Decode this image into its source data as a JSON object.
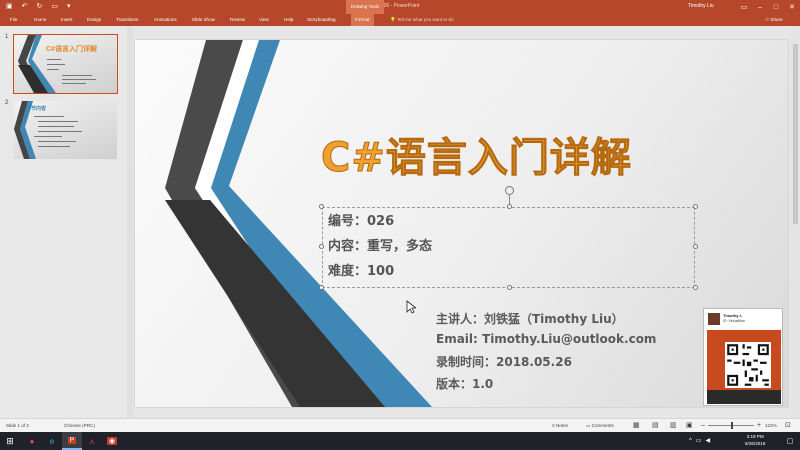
{
  "window": {
    "title": "326 - PowerPoint",
    "context_tab_group": "Drawing Tools",
    "user": "Timothy Liu",
    "qat_icons": [
      "save-icon",
      "undo-icon",
      "redo-icon",
      "present-icon",
      "customize-icon"
    ]
  },
  "ribbon": {
    "tabs": [
      "File",
      "Home",
      "Insert",
      "Design",
      "Transitions",
      "Animations",
      "Slide Show",
      "Review",
      "View",
      "Help",
      "Storyboarding",
      "Format"
    ],
    "active_tab": "Format",
    "tell_me": "Tell me what you want to do",
    "share": "Share"
  },
  "thumbnails": [
    {
      "number": "1",
      "title": "C#语言入门详解",
      "selected": true
    },
    {
      "number": "2",
      "title": "本节内容",
      "selected": false
    }
  ],
  "slide": {
    "title": "C#语言入门详解",
    "textbox_lines": [
      "编号：026",
      "内容：重写，多态",
      "难度：100"
    ],
    "info_lines": [
      "主讲人：刘铁猛（Timothy Liu）",
      "Email: Timothy.Liu@outlook.com",
      "录制时间：2018.05.26",
      "版本：1.0"
    ],
    "card_name": "Timothy L",
    "card_sub": "ID: VirtualMan"
  },
  "statusbar": {
    "slide_info": "Slide 1 of 2",
    "language": "Chinese (PRC)",
    "notes": "Notes",
    "comments": "Comments",
    "zoom": "122%"
  },
  "taskbar": {
    "time": "3:19 PM",
    "date": "5/26/2018"
  },
  "colors": {
    "accent": "#b7472a",
    "title_orange": "#f0a030",
    "stripe_blue": "#3f87b5",
    "stripe_dark": "#444444"
  }
}
